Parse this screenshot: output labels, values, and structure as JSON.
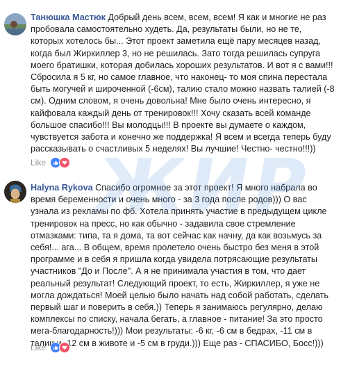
{
  "comments": [
    {
      "author": "Танюшка Мастюк",
      "text": "Добрый день всем, всем, всем! Я как и многие не раз пробовала самостоятельно худеть. Да, результаты были, но не те, которых хотелось бы... Этот проект заметила ещё пару месяцев назад, когда был Жиркиллер 3, но не решилась. Зато тогда решилась супруга моего братишки, которая добилась хороших результатов. И вот я с вами!!! Сбросила я 5 кг, но самое главное, что наконец- то моя спина перестала быть могучей и широченной (-6см), талию стало можно назвать талией (-8 см). Одним словом, я очень довольна! Мне было очень интересно, я кайфовала каждый день от тренировок!!! Хочу сказать всей команде большое спасибо!!! Вы молодцы!!! В проекте вы думаете о каждом, чувствуется забота и конечно же поддержка! Я всем и всегда теперь буду рассказывать о счастливых 5 неделях! Вы лучшие! Честно- честно!!!))",
      "like_label": "Like",
      "reactions": [
        "like-icon",
        "love-icon"
      ]
    },
    {
      "author": "Halyna Rykova",
      "text": "Спасибо огромное за этот проект! Я много набрала во время беременности и очень много - за 3 года после родов))) О вас узнала из рекламы по фб. Хотела принять участие в предыдущем цикле тренировок на пресс, но как обычно - задавила свое стремление отмазками: типа, та я дома, та вот сейчас как начну, да как возьмусь за себя!... ага... В общем, время пролетело очень быстро без меня в этой программе и в себя я пришла когда увидела потрясающие результаты участников \"До и После\". А я не принимала участия в том, что дает реальный результат! Следующий проект, то есть, Жиркиллер, я уже не могла дождаться! Моей целью было начать над собой работать, сделать первый шаг и поверить в себя.)) Теперь я занимаюсь регулярно, делаю комплексы по списку, начала бегать, а главное - питание! За это просто мега-благодарность!))) Мои результаты: -6 кг, -6 см в бедрах, -11 см в талии и -12 см в животе и -5 см в груди.))) Еще раз - СПАСИБО, Босс!)))",
      "like_label": "Like",
      "reactions": [
        "like-icon",
        "love-icon"
      ]
    }
  ],
  "watermark": "ЖИР",
  "colors": {
    "author_link": "#385898",
    "text": "#1c1e21",
    "meta": "#90949c",
    "like_reaction": "#4080ff",
    "love_reaction": "#f25268",
    "watermark": "#4080dc"
  }
}
